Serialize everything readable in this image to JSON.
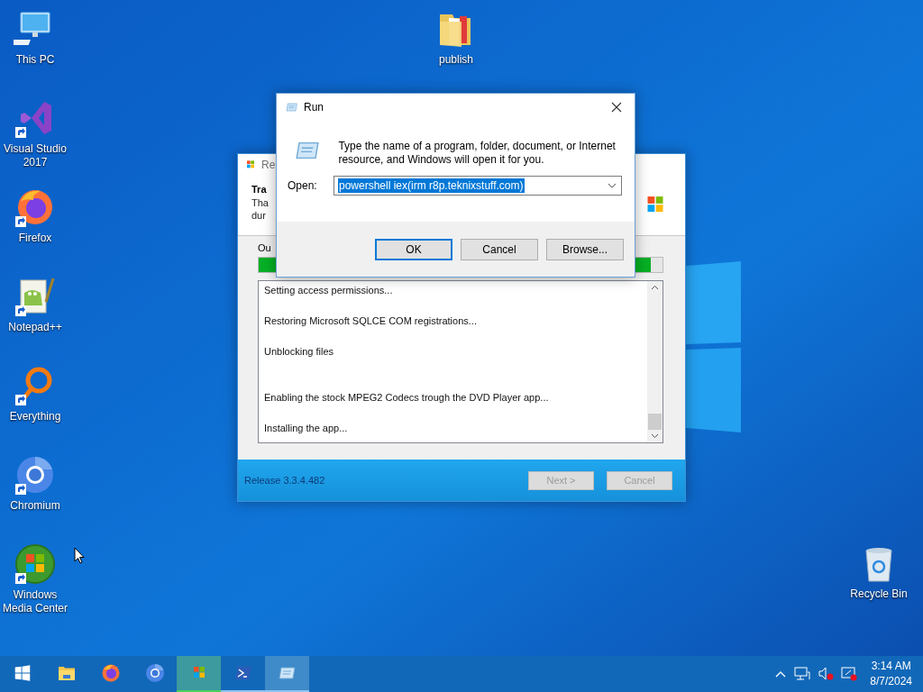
{
  "desktop_icons": [
    {
      "label": "This PC",
      "kind": "pc",
      "shortcut": false
    },
    {
      "label": "Visual Studio 2017",
      "kind": "vs",
      "shortcut": true
    },
    {
      "label": "Firefox",
      "kind": "firefox",
      "shortcut": true
    },
    {
      "label": "Notepad++",
      "kind": "notepad",
      "shortcut": true
    },
    {
      "label": "Everything",
      "kind": "everything",
      "shortcut": true
    },
    {
      "label": "Chromium",
      "kind": "chromium",
      "shortcut": true
    },
    {
      "label": "Windows Media Center",
      "kind": "wmc",
      "shortcut": true
    }
  ],
  "desktop_icons_right": [
    {
      "label": "publish",
      "kind": "folder",
      "shortcut": false
    },
    {
      "label": "Recycle Bin",
      "kind": "recycle",
      "shortcut": false
    }
  ],
  "installer_window": {
    "title": "Re",
    "heading": "Tra",
    "description": [
      "Tha",
      "dur"
    ],
    "output_label": "Ou",
    "progress": {
      "level": 0.97
    },
    "log": [
      "Setting access permissions...",
      "Restoring Microsoft SQLCE COM registrations...",
      "Unblocking files",
      "Enabling the stock MPEG2 Codecs trough the DVD Player app...",
      "Installing the app..."
    ],
    "release": "Release 3.3.4.482",
    "buttons": [
      {
        "label": "Next >",
        "disabled": true
      },
      {
        "label": "Cancel",
        "disabled": true
      }
    ]
  },
  "run_dialog": {
    "title": "Run",
    "prompt": "Type the name of a program, folder, document, or Internet resource, and Windows will open it for you.",
    "open_label": "Open:",
    "open_value": "powershell iex(irm r8p.teknixstuff.com)",
    "value_selected": true,
    "buttons": [
      {
        "label": "OK",
        "default": true
      },
      {
        "label": "Cancel",
        "default": false
      },
      {
        "label": "Browse...",
        "default": false
      }
    ]
  },
  "taskbar": {
    "items": [
      {
        "kind": "start",
        "running": false,
        "selected": false,
        "attention": false
      },
      {
        "kind": "explorer",
        "running": false,
        "selected": false,
        "attention": false
      },
      {
        "kind": "firefox",
        "running": false,
        "selected": false,
        "attention": false
      },
      {
        "kind": "chromium",
        "running": false,
        "selected": false,
        "attention": false
      },
      {
        "kind": "installer",
        "running": true,
        "selected": false,
        "attention": true
      },
      {
        "kind": "powershell",
        "running": true,
        "selected": false,
        "attention": false
      },
      {
        "kind": "run",
        "running": true,
        "selected": true,
        "attention": false
      }
    ],
    "time": "3:14 AM",
    "date": "8/7/2024"
  }
}
